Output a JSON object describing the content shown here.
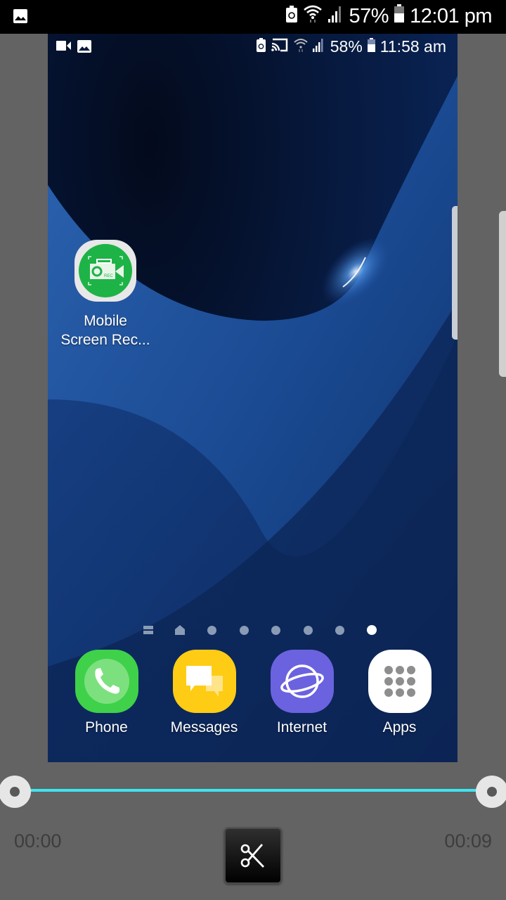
{
  "status_bar": {
    "notification_icon": "image-icon",
    "icons": [
      "battery-saver-icon",
      "wifi-icon",
      "signal-icon"
    ],
    "battery_percent": "57%",
    "time": "12:01 pm"
  },
  "preview": {
    "status_bar": {
      "left_icons": [
        "video-camera-icon",
        "image-icon"
      ],
      "icons": [
        "battery-saver-icon",
        "cast-icon",
        "wifi-icon",
        "signal-icon"
      ],
      "battery_percent": "58%",
      "time": "11:58 am"
    },
    "home_shortcut": {
      "label_line1": "Mobile",
      "label_line2": "Screen Rec...",
      "icon_badge": "REC"
    },
    "page_indicator": {
      "pages": [
        "menu",
        "home",
        "dot",
        "dot",
        "dot",
        "dot",
        "dot",
        "dot"
      ],
      "active_index": 7
    },
    "dock": [
      {
        "label": "Phone",
        "color": "#3fd14a"
      },
      {
        "label": "Messages",
        "color": "#ffcc15"
      },
      {
        "label": "Internet",
        "color": "#6b62e0"
      },
      {
        "label": "Apps",
        "color": "#ffffff"
      }
    ]
  },
  "trimmer": {
    "start_time": "00:00",
    "end_time": "00:09",
    "start_fraction": 0,
    "end_fraction": 1,
    "track_color": "#3ee5ee",
    "cut_button": "scissors-icon"
  }
}
